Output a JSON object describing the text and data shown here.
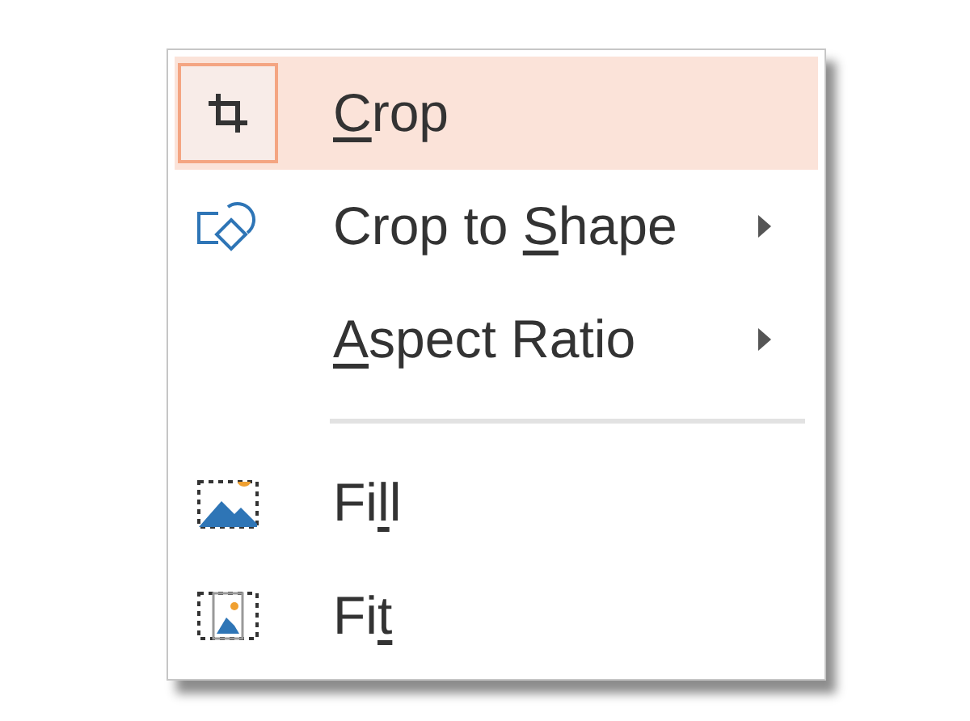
{
  "menu": {
    "items": [
      {
        "kind": "item",
        "key": "C",
        "after": "rop",
        "submenu": false,
        "selected": true
      },
      {
        "kind": "item",
        "before": "Crop to ",
        "key": "S",
        "after": "hape",
        "submenu": true,
        "selected": false
      },
      {
        "kind": "item",
        "key": "A",
        "after": "spect Ratio",
        "submenu": true,
        "selected": false
      },
      {
        "kind": "separator"
      },
      {
        "kind": "item",
        "before": "Fi",
        "key": "l",
        "after": "l",
        "submenu": false,
        "selected": false
      },
      {
        "kind": "item",
        "before": "Fi",
        "key": "t",
        "submenu": false,
        "selected": false
      }
    ]
  }
}
